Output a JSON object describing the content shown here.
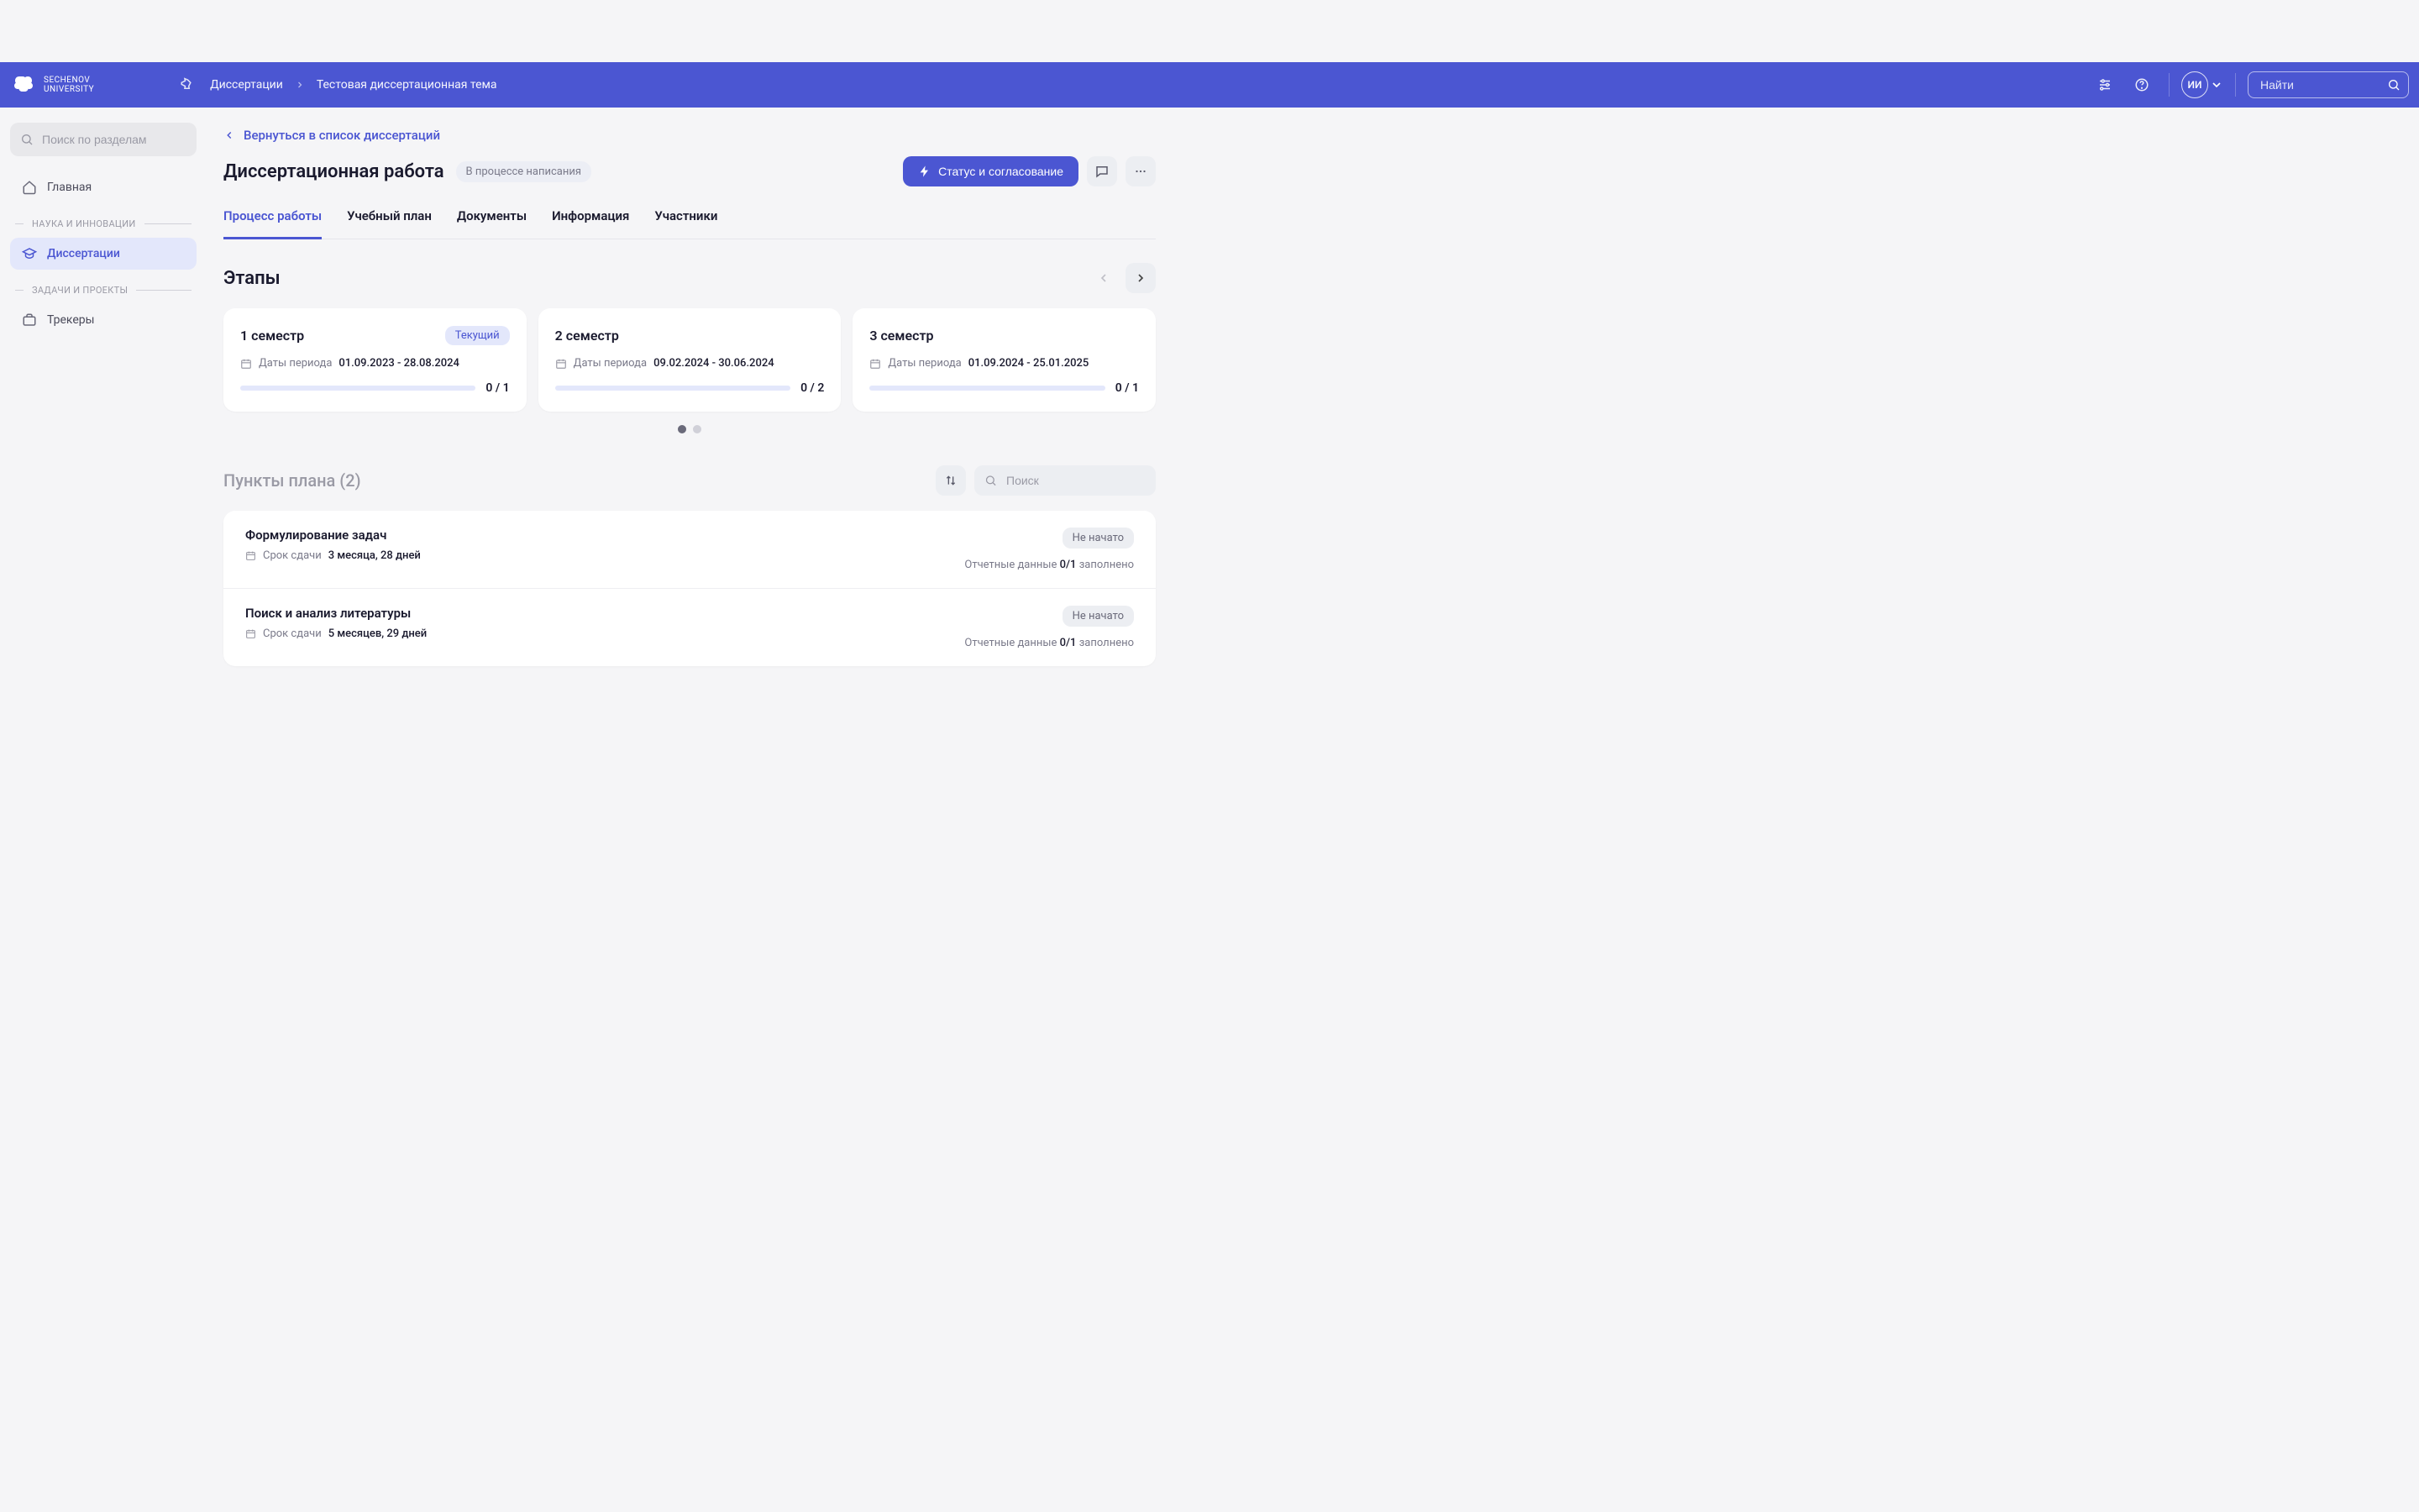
{
  "brand": {
    "name": "SECHENOV",
    "sub": "UNIVERSITY"
  },
  "breadcrumb": {
    "root": "Диссертации",
    "current": "Тестовая диссертационная тема"
  },
  "topSearch": {
    "placeholder": "Найти"
  },
  "user": {
    "initials": "ИИ"
  },
  "sidebar": {
    "searchPlaceholder": "Поиск по разделам",
    "home": "Главная",
    "sectionScience": "НАУКА И ИННОВАЦИИ",
    "dissertations": "Диссертации",
    "sectionTasks": "ЗАДАЧИ И ПРОЕКТЫ",
    "trackers": "Трекеры"
  },
  "page": {
    "backLabel": "Вернуться в список диссертаций",
    "title": "Диссертационная работа",
    "statusPill": "В процессе написания",
    "primaryBtn": "Статус и согласование"
  },
  "tabs": {
    "t1": "Процесс работы",
    "t2": "Учебный план",
    "t3": "Документы",
    "t4": "Информация",
    "t5": "Участники"
  },
  "stages": {
    "title": "Этапы",
    "datesLabel": "Даты периода",
    "currentBadge": "Текущий",
    "items": [
      {
        "title": "1 семестр",
        "dates": "01.09.2023 - 28.08.2024",
        "progress": "0 / 1",
        "current": true
      },
      {
        "title": "2 семестр",
        "dates": "09.02.2024 - 30.06.2024",
        "progress": "0 / 2",
        "current": false
      },
      {
        "title": "3 семестр",
        "dates": "01.09.2024 - 25.01.2025",
        "progress": "0 / 1",
        "current": false
      }
    ]
  },
  "plan": {
    "title": "Пункты плана",
    "count": "(2)",
    "searchPlaceholder": "Поиск",
    "dueLabel": "Срок сдачи",
    "reportLabel": "Отчетные данные",
    "reportSuffix": "заполнено",
    "items": [
      {
        "title": "Формулирование задач",
        "due": "3 месяца, 28 дней",
        "status": "Не начато",
        "report": "0/1"
      },
      {
        "title": "Поиск и анализ литературы",
        "due": "5 месяцев, 29 дней",
        "status": "Не начато",
        "report": "0/1"
      }
    ]
  }
}
